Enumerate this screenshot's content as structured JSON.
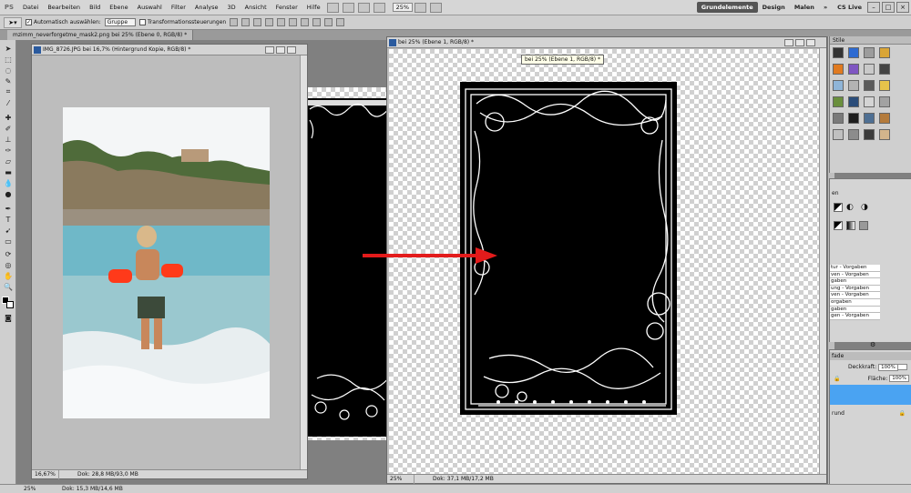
{
  "menubar": {
    "logo": "PS",
    "items": [
      "Datei",
      "Bearbeiten",
      "Bild",
      "Ebene",
      "Auswahl",
      "Filter",
      "Analyse",
      "3D",
      "Ansicht",
      "Fenster",
      "Hilfe"
    ],
    "zoom": "25%",
    "workspaces": [
      "Grundelemente",
      "Design",
      "Malen"
    ],
    "more": "»",
    "cs_live": "CS Live"
  },
  "options": {
    "auto_select_label": "Automatisch auswählen:",
    "auto_select_value": "Gruppe",
    "transform_label": "Transformationssteuerungen"
  },
  "tabs": {
    "label": "mzimm_neverforgetme_mask2.png bei 25% (Ebene 0, RGB/8) *"
  },
  "doc_photo": {
    "title": "IMG_8726.JPG bei 16,7% (Hintergrund Kopie, RGB/8) *",
    "zoom": "16,67%",
    "info": "Dok: 28,8 MB/93,0 MB"
  },
  "doc_frame": {
    "title": "bei 25% (Ebene 1, RGB/8) *",
    "tooltip": "bei 25% (Ebene 1, RGB/8) *",
    "zoom": "25%",
    "info": "Dok: 37,1 MB/17,2 MB"
  },
  "panels": {
    "styles_title": "Stile",
    "adjust_title": "en",
    "presets": [
      "tur - Vorgaben",
      "ven - Vorgaben",
      "gaben",
      "ung - Vorgaben",
      "ven - Vorgaben",
      "orgaben",
      "gaben",
      "gen - Vorgaben"
    ],
    "layers_tab": "fade",
    "opacity_label": "Deckkraft:",
    "opacity_value": "100%",
    "fill_label": "Fläche:",
    "fill_value": "100%",
    "layer_name": "rund"
  },
  "app_status": {
    "zoom": "25%",
    "info": "Dok: 15,3 MB/14,6 MB"
  },
  "colors": {
    "selected_layer": "#4aa3f2",
    "arrow": "#e31b1b",
    "frame": "#000000"
  }
}
